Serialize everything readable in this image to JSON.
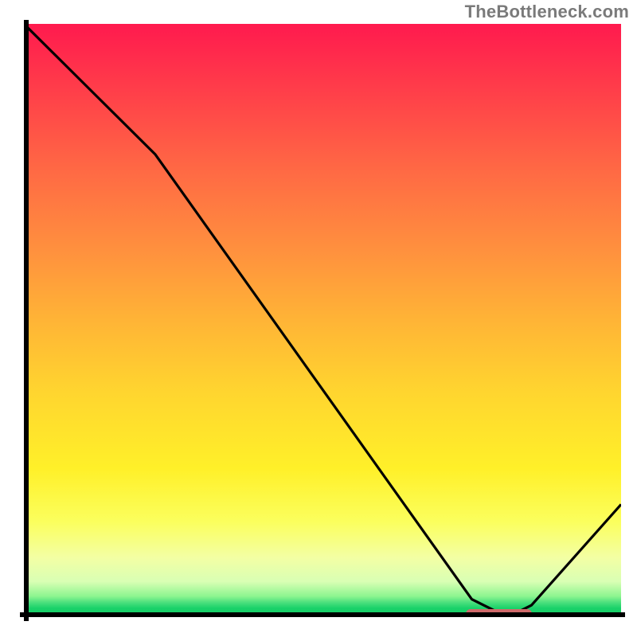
{
  "attribution": "TheBottleneck.com",
  "chart_data": {
    "type": "line",
    "title": "",
    "xlabel": "",
    "ylabel": "",
    "ylim": [
      0,
      100
    ],
    "xlim": [
      0,
      100
    ],
    "series": [
      {
        "name": "curve",
        "x": [
          0,
          22,
          75,
          80,
          82,
          85,
          100
        ],
        "values": [
          100,
          78,
          3,
          0.5,
          0.5,
          2,
          19
        ]
      }
    ],
    "optimal_band": {
      "x_start": 74,
      "x_end": 85,
      "y": 0.5
    },
    "background_gradient": {
      "stops": [
        {
          "pct": 0,
          "color": "#ff1a4e"
        },
        {
          "pct": 50,
          "color": "#ffb436"
        },
        {
          "pct": 75,
          "color": "#fff029"
        },
        {
          "pct": 96,
          "color": "#8cf58f"
        },
        {
          "pct": 100,
          "color": "#17cf67"
        }
      ]
    }
  }
}
